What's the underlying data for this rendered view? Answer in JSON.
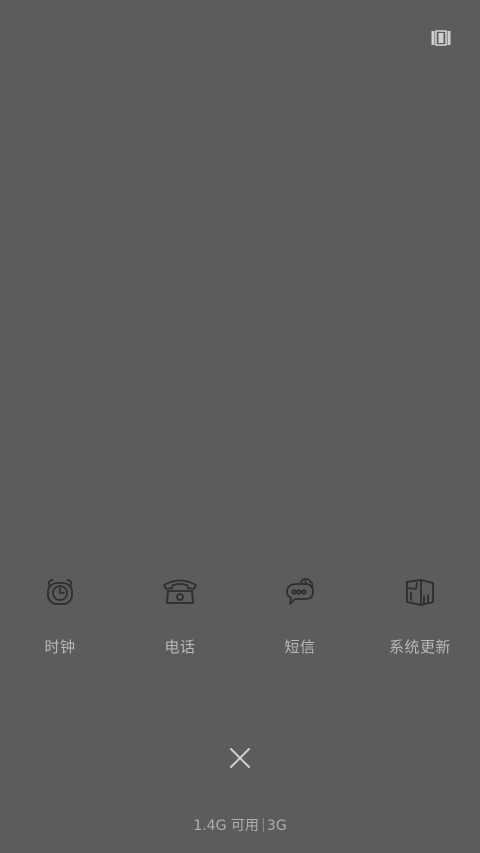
{
  "colors": {
    "background": "#5c5c5c",
    "icon_stroke": "#2e2e2e",
    "label_text": "#b8b8b8",
    "close_icon": "#cfcfcf"
  },
  "top_button": {
    "icon": "grid-view-icon"
  },
  "apps": [
    {
      "label": "时钟",
      "icon": "alarm-clock-icon"
    },
    {
      "label": "电话",
      "icon": "telephone-icon"
    },
    {
      "label": "短信",
      "icon": "message-bubble-icon"
    },
    {
      "label": "系统更新",
      "icon": "system-update-box-icon"
    }
  ],
  "close_button": {
    "icon": "close-icon"
  },
  "memory": {
    "available": "1.4G 可用",
    "network": "3G"
  }
}
